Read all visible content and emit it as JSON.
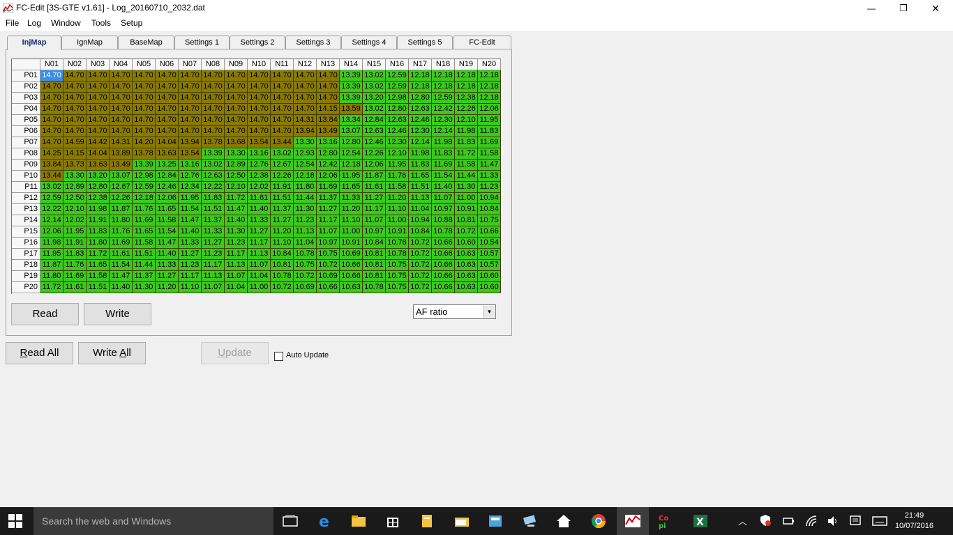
{
  "window": {
    "title": "FC-Edit [3S-GTE v1.61] - Log_20160710_2032.dat",
    "min_glyph": "—",
    "max_glyph": "❐",
    "close_glyph": "✕"
  },
  "menu": [
    "File",
    "Log",
    "Window",
    "Tools",
    "Setup"
  ],
  "tabs": [
    {
      "label": "InjMap",
      "active": true
    },
    {
      "label": "IgnMap"
    },
    {
      "label": "BaseMap"
    },
    {
      "label": "Settings 1"
    },
    {
      "label": "Settings 2"
    },
    {
      "label": "Settings 3"
    },
    {
      "label": "Settings 4"
    },
    {
      "label": "Settings 5"
    },
    {
      "label": "FC-Edit"
    }
  ],
  "grid": {
    "columns": [
      "N01",
      "N02",
      "N03",
      "N04",
      "N05",
      "N06",
      "N07",
      "N08",
      "N09",
      "N10",
      "N11",
      "N12",
      "N13",
      "N14",
      "N15",
      "N16",
      "N17",
      "N18",
      "N19",
      "N20"
    ],
    "rows": [
      {
        "label": "P01",
        "values": [
          "14.70",
          "14.70",
          "14.70",
          "14.70",
          "14.70",
          "14.70",
          "14.70",
          "14.70",
          "14.70",
          "14.70",
          "14.70",
          "14.70",
          "14.70",
          "13.39",
          "13.02",
          "12.59",
          "12.18",
          "12.18",
          "12.18",
          "12.18"
        ]
      },
      {
        "label": "P02",
        "values": [
          "14.70",
          "14.70",
          "14.70",
          "14.70",
          "14.70",
          "14.70",
          "14.70",
          "14.70",
          "14.70",
          "14.70",
          "14.70",
          "14.70",
          "14.70",
          "13.39",
          "13.02",
          "12.59",
          "12.18",
          "12.18",
          "12.18",
          "12.18"
        ]
      },
      {
        "label": "P03",
        "values": [
          "14.70",
          "14.70",
          "14.70",
          "14.70",
          "14.70",
          "14.70",
          "14.70",
          "14.70",
          "14.70",
          "14.70",
          "14.70",
          "14.70",
          "14.70",
          "13.39",
          "13.20",
          "12.98",
          "12.80",
          "12.59",
          "12.38",
          "12.18"
        ]
      },
      {
        "label": "P04",
        "values": [
          "14.70",
          "14.70",
          "14.70",
          "14.70",
          "14.70",
          "14.70",
          "14.70",
          "14.70",
          "14.70",
          "14.70",
          "14.70",
          "14.70",
          "14.15",
          "13.59",
          "13.02",
          "12.80",
          "12.63",
          "12.42",
          "12.26",
          "12.06"
        ]
      },
      {
        "label": "P05",
        "values": [
          "14.70",
          "14.70",
          "14.70",
          "14.70",
          "14.70",
          "14.70",
          "14.70",
          "14.70",
          "14.70",
          "14.70",
          "14.70",
          "14.31",
          "13.84",
          "13.34",
          "12.84",
          "12.63",
          "12.46",
          "12.30",
          "12.10",
          "11.95"
        ]
      },
      {
        "label": "P06",
        "values": [
          "14.70",
          "14.70",
          "14.70",
          "14.70",
          "14.70",
          "14.70",
          "14.70",
          "14.70",
          "14.70",
          "14.70",
          "14.70",
          "13.94",
          "13.49",
          "13.07",
          "12.63",
          "12.46",
          "12.30",
          "12.14",
          "11.98",
          "11.83"
        ]
      },
      {
        "label": "P07",
        "values": [
          "14.70",
          "14.59",
          "14.42",
          "14.31",
          "14.20",
          "14.04",
          "13.94",
          "13.78",
          "13.68",
          "13.54",
          "13.44",
          "13.30",
          "13.16",
          "12.80",
          "12.46",
          "12.30",
          "12.14",
          "11.98",
          "11.83",
          "11.69"
        ]
      },
      {
        "label": "P08",
        "values": [
          "14.25",
          "14.15",
          "14.04",
          "13.89",
          "13.78",
          "13.63",
          "13.54",
          "13.39",
          "13.30",
          "13.16",
          "13.02",
          "12.93",
          "12.80",
          "12.54",
          "12.26",
          "12.10",
          "11.98",
          "11.83",
          "11.72",
          "11.58"
        ]
      },
      {
        "label": "P09",
        "values": [
          "13.84",
          "13.73",
          "13.63",
          "13.49",
          "13.39",
          "13.25",
          "13.16",
          "13.02",
          "12.89",
          "12.76",
          "12.67",
          "12.54",
          "12.42",
          "12.18",
          "12.06",
          "11.95",
          "11.83",
          "11.69",
          "11.58",
          "11.47"
        ]
      },
      {
        "label": "P10",
        "values": [
          "13.44",
          "13.30",
          "13.20",
          "13.07",
          "12.98",
          "12.84",
          "12.76",
          "12.63",
          "12.50",
          "12.38",
          "12.26",
          "12.18",
          "12.06",
          "11.95",
          "11.87",
          "11.76",
          "11.65",
          "11.54",
          "11.44",
          "11.33"
        ]
      },
      {
        "label": "P11",
        "values": [
          "13.02",
          "12.89",
          "12.80",
          "12.67",
          "12.59",
          "12.46",
          "12.34",
          "12.22",
          "12.10",
          "12.02",
          "11.91",
          "11.80",
          "11.69",
          "11.65",
          "11.61",
          "11.58",
          "11.51",
          "11.40",
          "11.30",
          "11.23"
        ]
      },
      {
        "label": "P12",
        "values": [
          "12.59",
          "12.50",
          "12.38",
          "12.26",
          "12.18",
          "12.06",
          "11.95",
          "11.83",
          "11.72",
          "11.61",
          "11.51",
          "11.44",
          "11.37",
          "11.33",
          "11.27",
          "11.20",
          "11.13",
          "11.07",
          "11.00",
          "10.94"
        ]
      },
      {
        "label": "P13",
        "values": [
          "12.22",
          "12.10",
          "11.98",
          "11.87",
          "11.76",
          "11.65",
          "11.54",
          "11.51",
          "11.47",
          "11.40",
          "11.37",
          "11.30",
          "11.27",
          "11.20",
          "11.17",
          "11.10",
          "11.04",
          "10.97",
          "10.91",
          "10.84"
        ]
      },
      {
        "label": "P14",
        "values": [
          "12.14",
          "12.02",
          "11.91",
          "11.80",
          "11.69",
          "11.58",
          "11.47",
          "11.37",
          "11.40",
          "11.33",
          "11.27",
          "11.23",
          "11.17",
          "11.10",
          "11.07",
          "11.00",
          "10.94",
          "10.88",
          "10.81",
          "10.75"
        ]
      },
      {
        "label": "P15",
        "values": [
          "12.06",
          "11.95",
          "11.83",
          "11.76",
          "11.65",
          "11.54",
          "11.40",
          "11.33",
          "11.30",
          "11.27",
          "11.20",
          "11.13",
          "11.07",
          "11.00",
          "10.97",
          "10.91",
          "10.84",
          "10.78",
          "10.72",
          "10.66"
        ]
      },
      {
        "label": "P16",
        "values": [
          "11.98",
          "11.91",
          "11.80",
          "11.69",
          "11.58",
          "11.47",
          "11.33",
          "11.27",
          "11.23",
          "11.17",
          "11.10",
          "11.04",
          "10.97",
          "10.91",
          "10.84",
          "10.78",
          "10.72",
          "10.66",
          "10.60",
          "10.54"
        ]
      },
      {
        "label": "P17",
        "values": [
          "11.95",
          "11.83",
          "11.72",
          "11.61",
          "11.51",
          "11.40",
          "11.27",
          "11.23",
          "11.17",
          "11.13",
          "10.84",
          "10.78",
          "10.75",
          "10.69",
          "10.81",
          "10.78",
          "10.72",
          "10.66",
          "10.63",
          "10.57"
        ]
      },
      {
        "label": "P18",
        "values": [
          "11.87",
          "11.76",
          "11.65",
          "11.54",
          "11.44",
          "11.33",
          "11.23",
          "11.17",
          "11.13",
          "11.07",
          "10.81",
          "10.75",
          "10.72",
          "10.66",
          "10.81",
          "10.75",
          "10.72",
          "10.66",
          "10.63",
          "10.57"
        ]
      },
      {
        "label": "P19",
        "values": [
          "11.80",
          "11.69",
          "11.58",
          "11.47",
          "11.37",
          "11.27",
          "11.17",
          "11.13",
          "11.07",
          "11.04",
          "10.78",
          "10.72",
          "10.69",
          "10.66",
          "10.81",
          "10.75",
          "10.72",
          "10.66",
          "10.63",
          "10.60"
        ]
      },
      {
        "label": "P20",
        "values": [
          "11.72",
          "11.61",
          "11.51",
          "11.40",
          "11.30",
          "11.20",
          "11.10",
          "11.07",
          "11.04",
          "11.00",
          "10.72",
          "10.69",
          "10.66",
          "10.63",
          "10.78",
          "10.75",
          "10.72",
          "10.66",
          "10.63",
          "10.60"
        ]
      }
    ],
    "selected": {
      "row": 0,
      "col": 0
    },
    "colors": {
      "lean": "#8a7a00",
      "rich": "#3dc81e",
      "selected": "#3b8de8",
      "selected_text": "#ffffff"
    }
  },
  "buttons": {
    "read": "Read",
    "write": "Write",
    "read_all": "Read All",
    "write_all": "Write All",
    "update": "Update"
  },
  "display_select": {
    "value": "AF ratio"
  },
  "auto_update": {
    "label": "Auto Update",
    "checked": false
  },
  "taskbar": {
    "search_placeholder": "Search the web and Windows",
    "time": "21:49",
    "date": "10/07/2016"
  }
}
